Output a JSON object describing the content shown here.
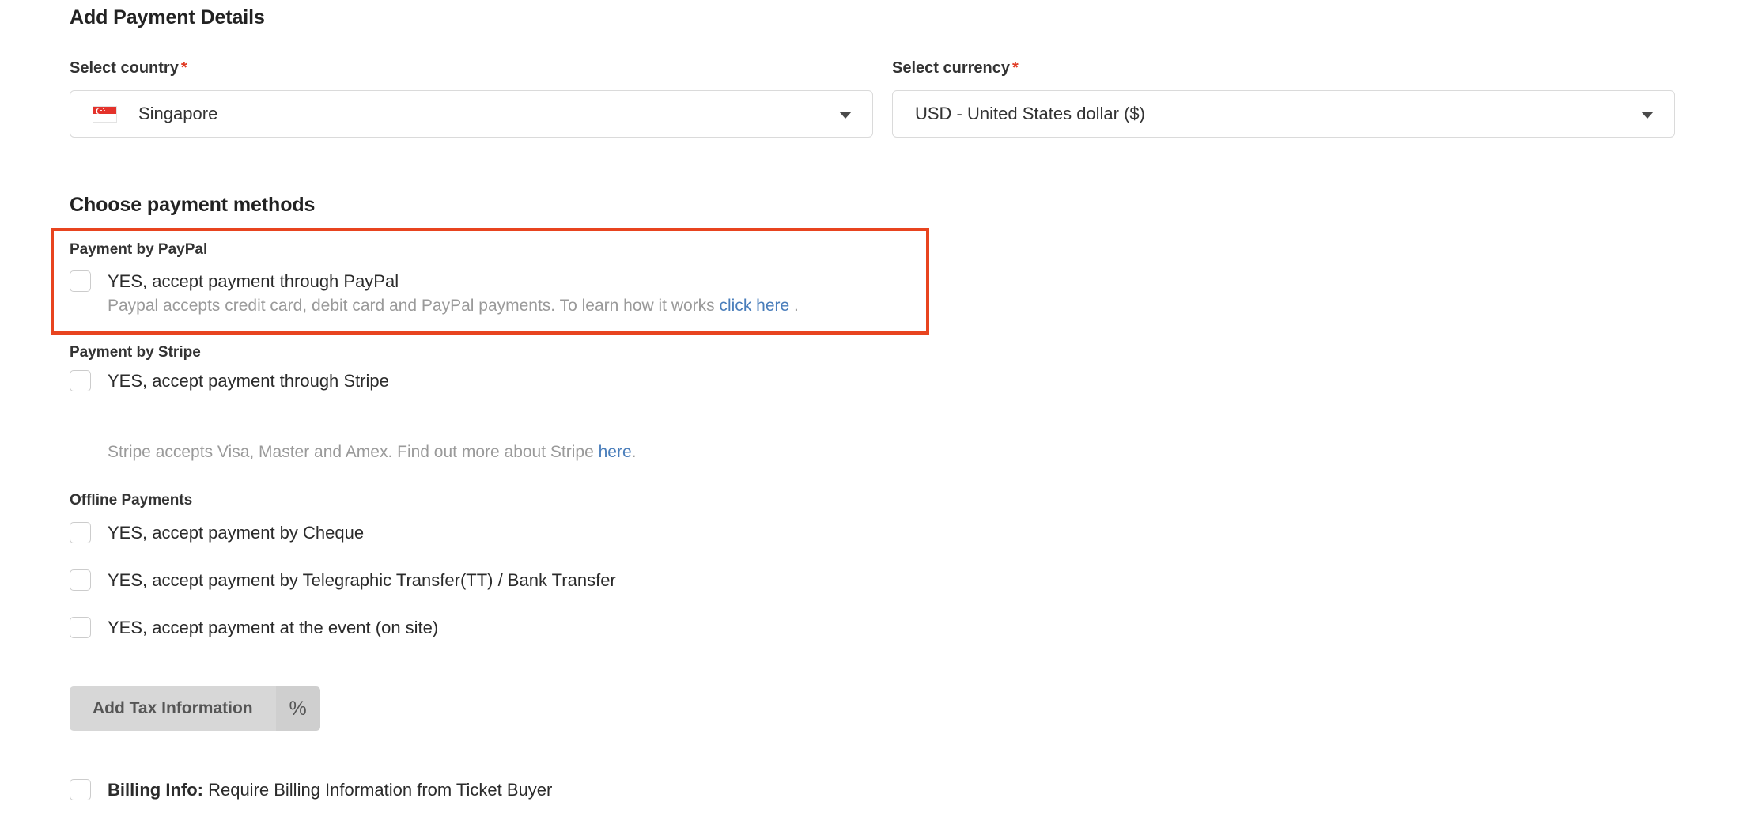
{
  "page": {
    "title": "Add Payment Details",
    "methods_heading": "Choose payment methods"
  },
  "country": {
    "label": "Select country",
    "required_mark": "*",
    "value": "Singapore",
    "flag": "singapore-flag-icon",
    "caret": "chevron-down-icon"
  },
  "currency": {
    "label": "Select currency",
    "required_mark": "*",
    "value": "USD - United States dollar ($)",
    "caret": "chevron-down-icon"
  },
  "paypal": {
    "group_title": "Payment by PayPal",
    "checkbox_label": "YES, accept payment through PayPal",
    "checked": false,
    "description_before": "Paypal accepts credit card, debit card and PayPal payments. To learn how it works ",
    "link_text": "click here",
    "description_after": " .",
    "highlight_color": "#e8441f"
  },
  "stripe": {
    "group_title": "Payment by Stripe",
    "checkbox_label": "YES, accept payment through Stripe",
    "checked": false,
    "description_before": "Stripe accepts Visa, Master and Amex. Find out more about Stripe ",
    "link_text": "here",
    "description_after": "."
  },
  "offline": {
    "group_title": "Offline Payments",
    "items": [
      {
        "label": "YES, accept payment by Cheque",
        "checked": false
      },
      {
        "label": "YES, accept payment by Telegraphic Transfer(TT) / Bank Transfer",
        "checked": false
      },
      {
        "label": "YES, accept payment at the event (on site)",
        "checked": false
      }
    ]
  },
  "tax_button": {
    "label": "Add Tax Information",
    "icon": "percent-icon",
    "icon_glyph": "%"
  },
  "billing": {
    "label_bold": "Billing Info:",
    "label_rest": " Require Billing Information from Ticket Buyer",
    "checked": false
  },
  "colors": {
    "link": "#4a7ebb",
    "required": "#e03b24",
    "highlight": "#e8441f",
    "muted_text": "#9a9a9a"
  }
}
